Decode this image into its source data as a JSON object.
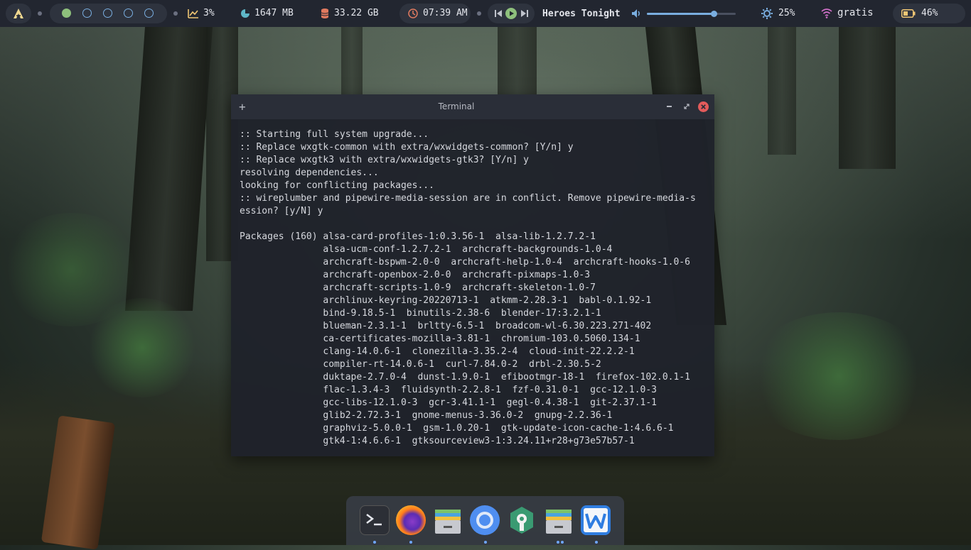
{
  "topbar": {
    "cpu": "3%",
    "memory": "1647 MB",
    "disk": "33.22 GB",
    "clock": "07:39 AM",
    "track": "Heroes Tonight",
    "volume_level": 0.75,
    "brightness": "25%",
    "network": "gratis",
    "battery": "46%"
  },
  "terminal": {
    "title": "Terminal",
    "lines": [
      ":: Starting full system upgrade...",
      ":: Replace wxgtk-common with extra/wxwidgets-common? [Y/n] y",
      ":: Replace wxgtk3 with extra/wxwidgets-gtk3? [Y/n] y",
      "resolving dependencies...",
      "looking for conflicting packages...",
      ":: wireplumber and pipewire-media-session are in conflict. Remove pipewire-media-s",
      "ession? [y/N] y",
      "",
      "Packages (160) alsa-card-profiles-1:0.3.56-1  alsa-lib-1.2.7.2-1",
      "               alsa-ucm-conf-1.2.7.2-1  archcraft-backgrounds-1.0-4",
      "               archcraft-bspwm-2.0-0  archcraft-help-1.0-4  archcraft-hooks-1.0-6",
      "               archcraft-openbox-2.0-0  archcraft-pixmaps-1.0-3",
      "               archcraft-scripts-1.0-9  archcraft-skeleton-1.0-7",
      "               archlinux-keyring-20220713-1  atkmm-2.28.3-1  babl-0.1.92-1",
      "               bind-9.18.5-1  binutils-2.38-6  blender-17:3.2.1-1",
      "               blueman-2.3.1-1  brltty-6.5-1  broadcom-wl-6.30.223.271-402",
      "               ca-certificates-mozilla-3.81-1  chromium-103.0.5060.134-1",
      "               clang-14.0.6-1  clonezilla-3.35.2-4  cloud-init-22.2.2-1",
      "               compiler-rt-14.0.6-1  curl-7.84.0-2  drbl-2.30.5-2",
      "               duktape-2.7.0-4  dunst-1.9.0-1  efibootmgr-18-1  firefox-102.0.1-1",
      "               flac-1.3.4-3  fluidsynth-2.2.8-1  fzf-0.31.0-1  gcc-12.1.0-3",
      "               gcc-libs-12.1.0-3  gcr-3.41.1-1  gegl-0.4.38-1  git-2.37.1-1",
      "               glib2-2.72.3-1  gnome-menus-3.36.0-2  gnupg-2.2.36-1",
      "               graphviz-5.0.0-1  gsm-1.0.20-1  gtk-update-icon-cache-1:4.6.6-1",
      "               gtk4-1:4.6.6-1  gtksourceview3-1:3.24.11+r28+g73e57b57-1"
    ]
  },
  "dock": {
    "apps": [
      "terminal-icon",
      "firefox-icon",
      "file-manager-icon",
      "chromium-icon",
      "settings-icon",
      "file-manager-icon",
      "wps-writer-icon"
    ]
  }
}
